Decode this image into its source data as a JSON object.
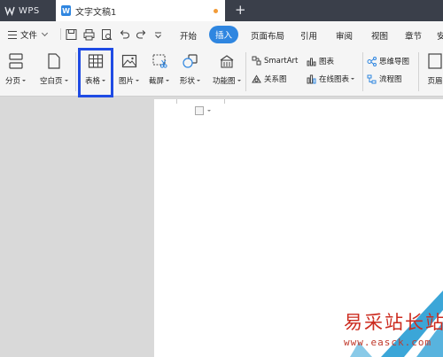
{
  "titlebar": {
    "app_tab_label": "WPS",
    "doc_tab_label": "文字文稿1",
    "doc_icon_letter": "W",
    "unsaved_dot_color": "#f29b38",
    "new_tab_symbol": "+"
  },
  "menu": {
    "file_label": "文件",
    "tabs": [
      "开始",
      "插入",
      "页面布局",
      "引用",
      "审阅",
      "视图",
      "章节",
      "安"
    ],
    "active_tab": "插入",
    "accent_color": "#2f86e0"
  },
  "ribbon": {
    "buttons": [
      {
        "label": "分页",
        "icon": "page-break-icon"
      },
      {
        "label": "空白页",
        "icon": "blank-page-icon"
      },
      {
        "label": "表格",
        "icon": "table-grid-icon"
      },
      {
        "label": "图片",
        "icon": "picture-icon"
      },
      {
        "label": "截屏",
        "icon": "screenshot-icon"
      },
      {
        "label": "形状",
        "icon": "shapes-icon"
      },
      {
        "label": "功能图",
        "icon": "function-chart-icon"
      }
    ],
    "small_items": [
      {
        "label": "SmartArt",
        "icon": "smartart-icon"
      },
      {
        "label": "图表",
        "icon": "chart-icon"
      },
      {
        "label": "关系图",
        "icon": "relation-chart-icon"
      },
      {
        "label": "在线图表",
        "icon": "online-chart-icon"
      },
      {
        "label": "思维导图",
        "icon": "mind-map-icon"
      },
      {
        "label": "流程图",
        "icon": "flowchart-icon"
      },
      {
        "label": "页眉",
        "icon": "header-icon"
      }
    ],
    "highlighted_button": "表格",
    "highlight_color": "#1f4be4"
  },
  "watermark": {
    "text": "易采站长站",
    "url": "www.easck.com"
  }
}
